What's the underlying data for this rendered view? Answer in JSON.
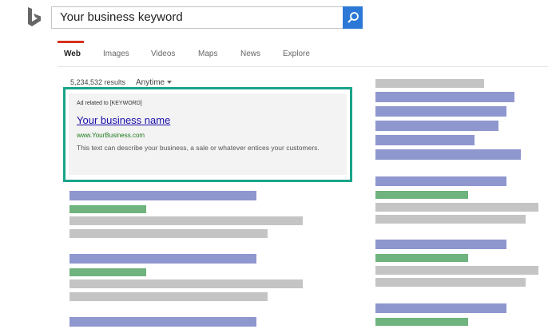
{
  "search": {
    "query": "Your business keyword"
  },
  "tabs": [
    {
      "label": "Web",
      "active": true
    },
    {
      "label": "Images"
    },
    {
      "label": "Videos"
    },
    {
      "label": "Maps"
    },
    {
      "label": "News"
    },
    {
      "label": "Explore"
    }
  ],
  "results": {
    "count": "5,234,532 results",
    "filter_label": "Anytime"
  },
  "ad": {
    "label": "Ad related to [KEYWORD]",
    "title": "Your business name",
    "url": "www.YourBusiness.com",
    "description": "This text can describe your business, a sale or whatever entices your customers."
  },
  "colors": {
    "accent": "#2b78d6",
    "active_tab": "#d6321e",
    "ad_frame": "#19a48a",
    "placeholder_title": "#8f97cf",
    "placeholder_url": "#6fb37e",
    "placeholder_text": "#c4c4c4"
  }
}
